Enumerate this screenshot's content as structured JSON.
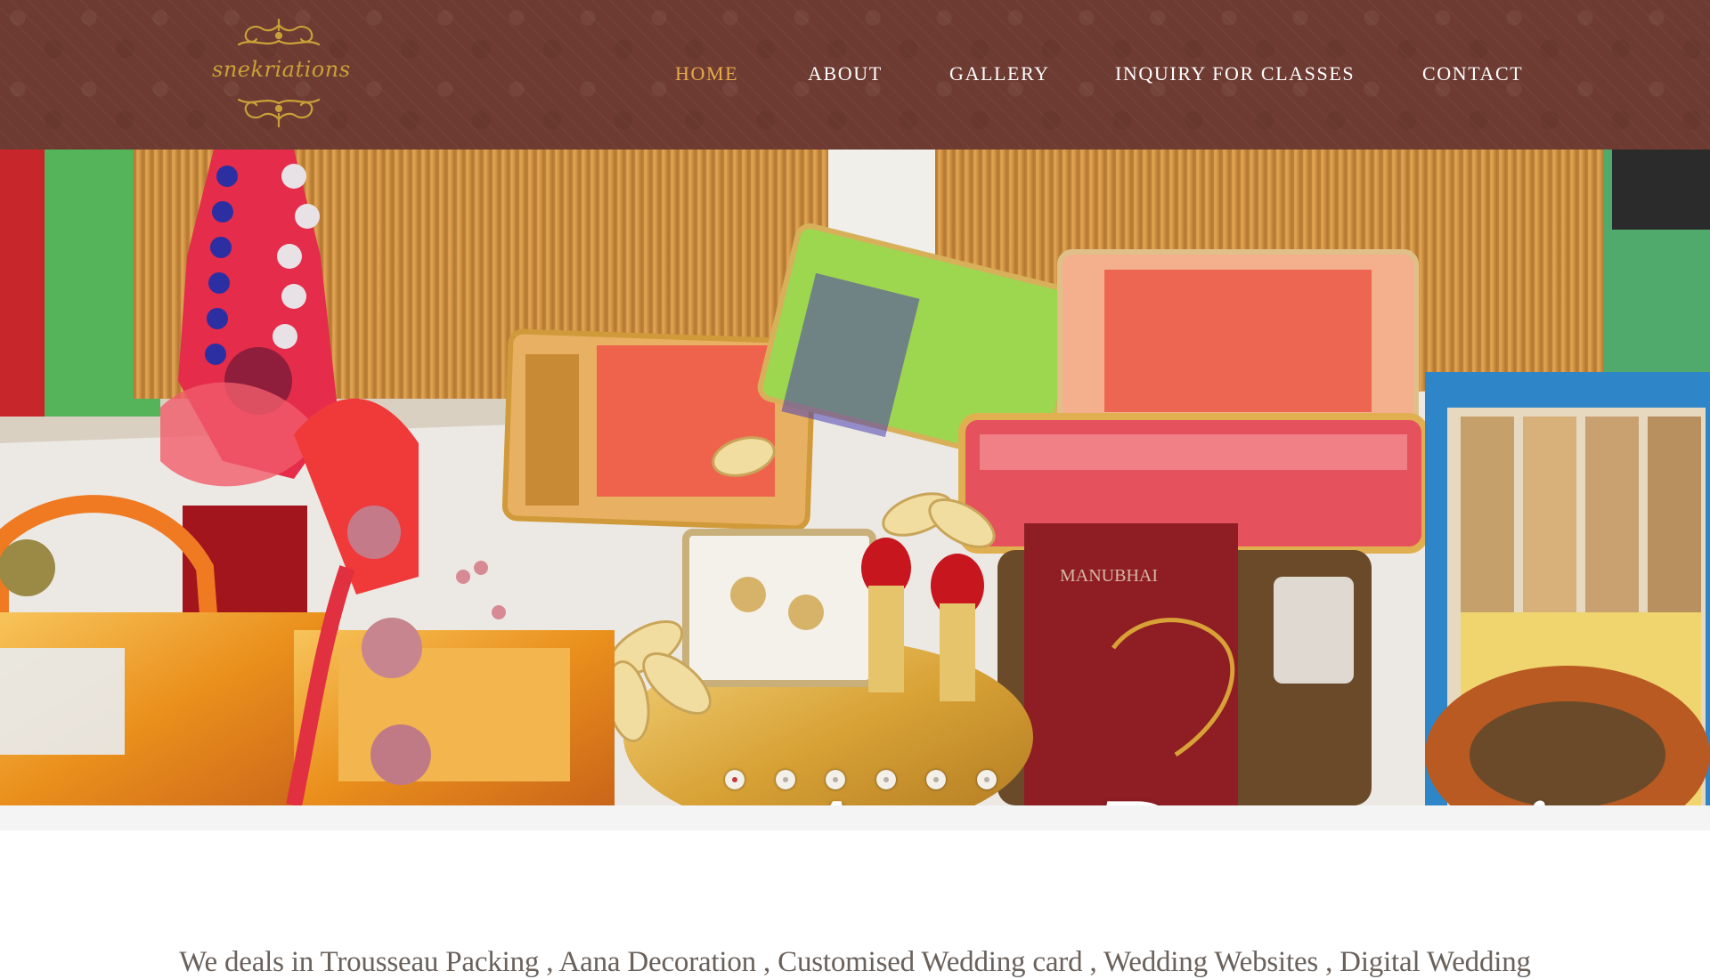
{
  "brand": {
    "logo_text": "snekriations"
  },
  "nav": {
    "items": [
      {
        "label": "HOME",
        "active": true
      },
      {
        "label": "ABOUT",
        "active": false
      },
      {
        "label": "GALLERY",
        "active": false
      },
      {
        "label": "INQUIRY FOR CLASSES",
        "active": false
      },
      {
        "label": "CONTACT",
        "active": false
      }
    ]
  },
  "hero": {
    "caption": "Aana Decoration",
    "slides_count": 6,
    "active_slide": 1
  },
  "tagline": "We deals in Trousseau Packing , Aana Decoration , Customised Wedding card , Wedding Websites , Digital Wedding",
  "colors": {
    "header_bg": "#6e3b32",
    "nav_active": "#e8ab4a",
    "nav_text": "#ffffff",
    "logo_gold": "#c9a038",
    "tagline_text": "#6a615b"
  }
}
